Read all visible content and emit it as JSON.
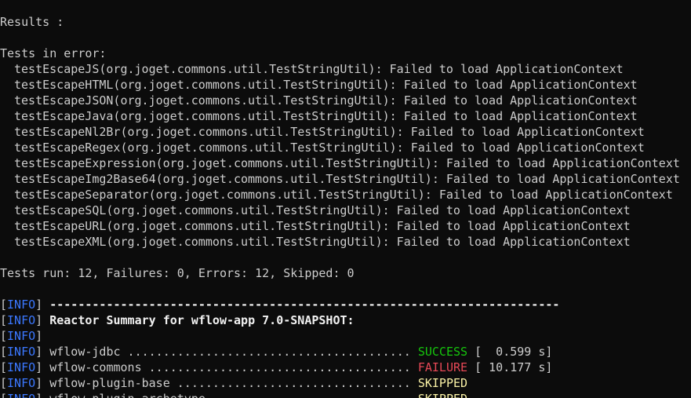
{
  "terminal": {
    "results_heading": "Results :",
    "errors_heading": "Tests in error:",
    "error_lines": [
      "testEscapeJS(org.joget.commons.util.TestStringUtil): Failed to load ApplicationContext",
      "testEscapeHTML(org.joget.commons.util.TestStringUtil): Failed to load ApplicationContext",
      "testEscapeJSON(org.joget.commons.util.TestStringUtil): Failed to load ApplicationContext",
      "testEscapeJava(org.joget.commons.util.TestStringUtil): Failed to load ApplicationContext",
      "testEscapeNl2Br(org.joget.commons.util.TestStringUtil): Failed to load ApplicationContext",
      "testEscapeRegex(org.joget.commons.util.TestStringUtil): Failed to load ApplicationContext",
      "testEscapeExpression(org.joget.commons.util.TestStringUtil): Failed to load ApplicationContext",
      "testEscapeImg2Base64(org.joget.commons.util.TestStringUtil): Failed to load ApplicationContext",
      "testEscapeSeparator(org.joget.commons.util.TestStringUtil): Failed to load ApplicationContext",
      "testEscapeSQL(org.joget.commons.util.TestStringUtil): Failed to load ApplicationContext",
      "testEscapeURL(org.joget.commons.util.TestStringUtil): Failed to load ApplicationContext",
      "testEscapeXML(org.joget.commons.util.TestStringUtil): Failed to load ApplicationContext"
    ],
    "summary_line": "Tests run: 12, Failures: 0, Errors: 12, Skipped: 0",
    "info_tag": "INFO",
    "separator": "------------------------------------------------------------------------",
    "reactor_title": "Reactor Summary for wflow-app 7.0-SNAPSHOT:",
    "modules": [
      {
        "name": "wflow-jdbc ........................................ ",
        "status": "SUCCESS",
        "time": " [  0.599 s]"
      },
      {
        "name": "wflow-commons ..................................... ",
        "status": "FAILURE",
        "time": " [ 10.177 s]"
      },
      {
        "name": "wflow-plugin-base ................................. ",
        "status": "SKIPPED",
        "time": ""
      },
      {
        "name": "wflow-plugin-archetype ............................ ",
        "status": "SKIPPED",
        "time": ""
      }
    ],
    "colors": {
      "background": "#0c0c0c",
      "text": "#cccccc",
      "info_tag": "#3b78ff",
      "success": "#16c60c",
      "failure": "#e74856",
      "skipped": "#f9f1a5",
      "bold": "#f2f2f2"
    }
  }
}
